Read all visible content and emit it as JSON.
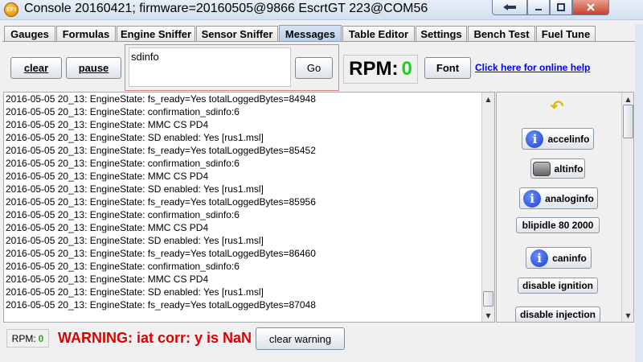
{
  "window": {
    "title": "Console 20160421; firmware=20160505@9866 EscrtGT 223@COM56",
    "app_icon_text": "EFI",
    "accent_color": "#b9cfe9"
  },
  "tabs": [
    {
      "label": "Gauges"
    },
    {
      "label": "Formulas"
    },
    {
      "label": "Engine Sniffer"
    },
    {
      "label": "Sensor Sniffer"
    },
    {
      "label": "Messages",
      "active": true
    },
    {
      "label": "Table Editor"
    },
    {
      "label": "Settings"
    },
    {
      "label": "Bench Test"
    },
    {
      "label": "Fuel Tune"
    }
  ],
  "toolbar": {
    "clear_label": "clear",
    "pause_label": "pause",
    "command_value": "sdinfo",
    "go_label": "Go",
    "rpm_label": "RPM:",
    "rpm_value": "0",
    "font_label": "Font",
    "help_link": "Click here for online help"
  },
  "log": {
    "lines": [
      "2016-05-05 20_13: EngineState: fs_ready=Yes totalLoggedBytes=84948",
      "2016-05-05 20_13: EngineState: confirmation_sdinfo:6",
      "2016-05-05 20_13: EngineState: MMC CS PD4",
      "2016-05-05 20_13: EngineState: SD enabled: Yes [rus1.msl]",
      "2016-05-05 20_13: EngineState: fs_ready=Yes totalLoggedBytes=85452",
      "2016-05-05 20_13: EngineState: confirmation_sdinfo:6",
      "2016-05-05 20_13: EngineState: MMC CS PD4",
      "2016-05-05 20_13: EngineState: SD enabled: Yes [rus1.msl]",
      "2016-05-05 20_13: EngineState: fs_ready=Yes totalLoggedBytes=85956",
      "2016-05-05 20_13: EngineState: confirmation_sdinfo:6",
      "2016-05-05 20_13: EngineState: MMC CS PD4",
      "2016-05-05 20_13: EngineState: SD enabled: Yes [rus1.msl]",
      "2016-05-05 20_13: EngineState: fs_ready=Yes totalLoggedBytes=86460",
      "2016-05-05 20_13: EngineState: confirmation_sdinfo:6",
      "2016-05-05 20_13: EngineState: MMC CS PD4",
      "2016-05-05 20_13: EngineState: SD enabled: Yes [rus1.msl]",
      "2016-05-05 20_13: EngineState: fs_ready=Yes totalLoggedBytes=87048"
    ]
  },
  "commands": {
    "items": [
      {
        "label": "accelinfo",
        "icon": "info-icon"
      },
      {
        "label": "altinfo",
        "icon": "alternator-icon"
      },
      {
        "label": "analoginfo",
        "icon": "info-icon"
      },
      {
        "label": "blipidle 80 2000",
        "icon": ""
      },
      {
        "label": "caninfo",
        "icon": "info-icon"
      },
      {
        "label": "disable ignition",
        "icon": ""
      },
      {
        "label": "disable injection",
        "icon": ""
      }
    ],
    "undo_icon": "undo-arrow-icon"
  },
  "status": {
    "rpm_label": "RPM:",
    "rpm_value": "0",
    "warning_text": "WARNING: iat corr: y is NaN",
    "clear_warning_label": "clear warning"
  }
}
